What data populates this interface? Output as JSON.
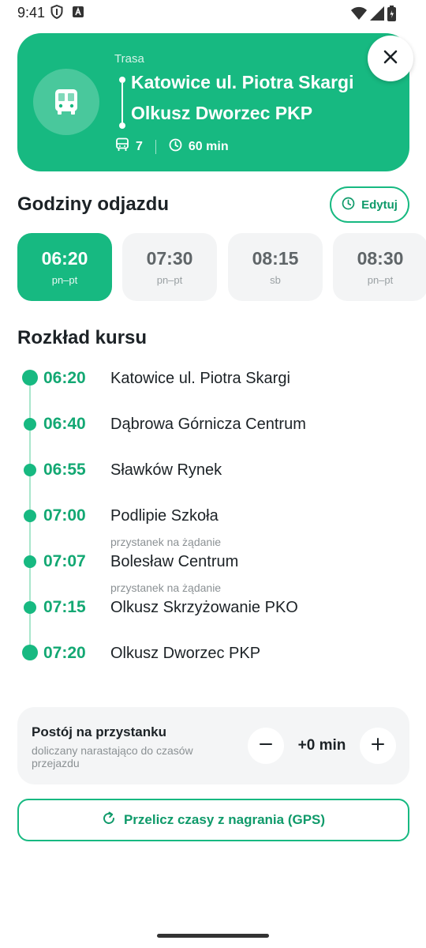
{
  "status_bar": {
    "time": "9:41"
  },
  "route": {
    "label": "Trasa",
    "from": "Katowice ul. Piotra Skargi",
    "to": "Olkusz Dworzec PKP",
    "stops_count": "7",
    "duration": "60 min"
  },
  "departures": {
    "title": "Godziny odjazdu",
    "edit_label": "Edytuj",
    "items": [
      {
        "time": "06:20",
        "days": "pn–pt",
        "active": true
      },
      {
        "time": "07:30",
        "days": "pn–pt",
        "active": false
      },
      {
        "time": "08:15",
        "days": "sb",
        "active": false
      },
      {
        "time": "08:30",
        "days": "pn–pt",
        "active": false
      }
    ]
  },
  "schedule": {
    "title": "Rozkład kursu",
    "stops": [
      {
        "time": "06:20",
        "name": "Katowice ul. Piotra Skargi",
        "note": ""
      },
      {
        "time": "06:40",
        "name": "Dąbrowa Górnicza Centrum",
        "note": ""
      },
      {
        "time": "06:55",
        "name": "Sławków Rynek",
        "note": ""
      },
      {
        "time": "07:00",
        "name": "Podlipie Szkoła",
        "note": ""
      },
      {
        "time": "07:07",
        "name": "Bolesław Centrum",
        "note": "przystanek na żądanie"
      },
      {
        "time": "07:15",
        "name": "Olkusz Skrzyżowanie PKO",
        "note": "przystanek na żądanie"
      },
      {
        "time": "07:20",
        "name": "Olkusz Dworzec PKP",
        "note": ""
      }
    ]
  },
  "dwell": {
    "title": "Postój na przystanku",
    "subtitle": "doliczany narastająco do czasów przejazdu",
    "value": "+0 min"
  },
  "gps_button": {
    "label": "Przelicz czasy z nagrania (GPS)"
  },
  "colors": {
    "accent": "#17b981",
    "accent_text": "#13a873",
    "timeline": "#a9e6cc"
  },
  "icons": [
    "shield-icon",
    "a-icon",
    "wifi-icon",
    "signal-icon",
    "battery-icon",
    "bus-icon",
    "close-icon",
    "clock-icon",
    "minus-icon",
    "plus-icon",
    "refresh-icon"
  ]
}
